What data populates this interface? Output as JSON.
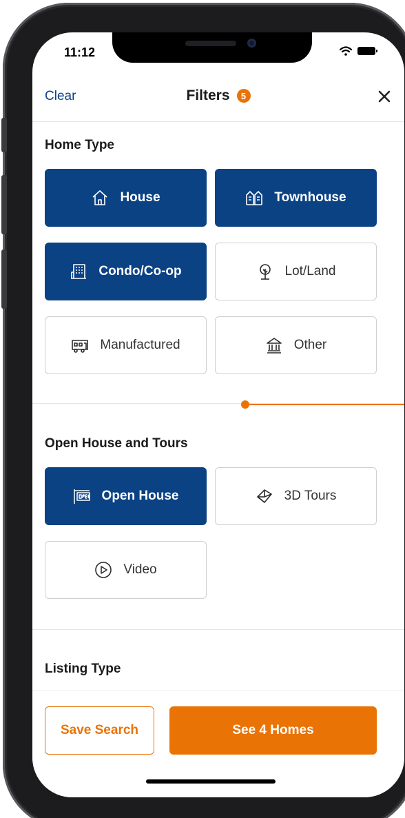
{
  "status_bar": {
    "time": "11:12",
    "wifi_icon": "wifi-icon",
    "battery_icon": "battery-icon"
  },
  "header": {
    "clear_label": "Clear",
    "title": "Filters",
    "count": "5",
    "close_icon": "close-icon"
  },
  "home_type": {
    "title": "Home Type",
    "options": [
      {
        "label": "House",
        "icon": "house-icon",
        "selected": true
      },
      {
        "label": "Townhouse",
        "icon": "townhouse-icon",
        "selected": true
      },
      {
        "label": "Condo/Co-op",
        "icon": "condo-icon",
        "selected": true
      },
      {
        "label": "Lot/Land",
        "icon": "tree-icon",
        "selected": false
      },
      {
        "label": "Manufactured",
        "icon": "manufactured-home-icon",
        "selected": false
      },
      {
        "label": "Other",
        "icon": "bank-building-icon",
        "selected": false
      }
    ]
  },
  "open_house": {
    "title": "Open House and Tours",
    "options": [
      {
        "label": "Open House",
        "icon": "open-sign-icon",
        "selected": true
      },
      {
        "label": "3D Tours",
        "icon": "cube-icon",
        "selected": false
      },
      {
        "label": "Video",
        "icon": "play-circle-icon",
        "selected": false
      }
    ]
  },
  "listing_type": {
    "title": "Listing Type"
  },
  "footer": {
    "save_label": "Save Search",
    "see_label": "See 4 Homes"
  },
  "colors": {
    "primary": "#0b4284",
    "accent": "#ea7306",
    "border": "#cfcfcf"
  }
}
